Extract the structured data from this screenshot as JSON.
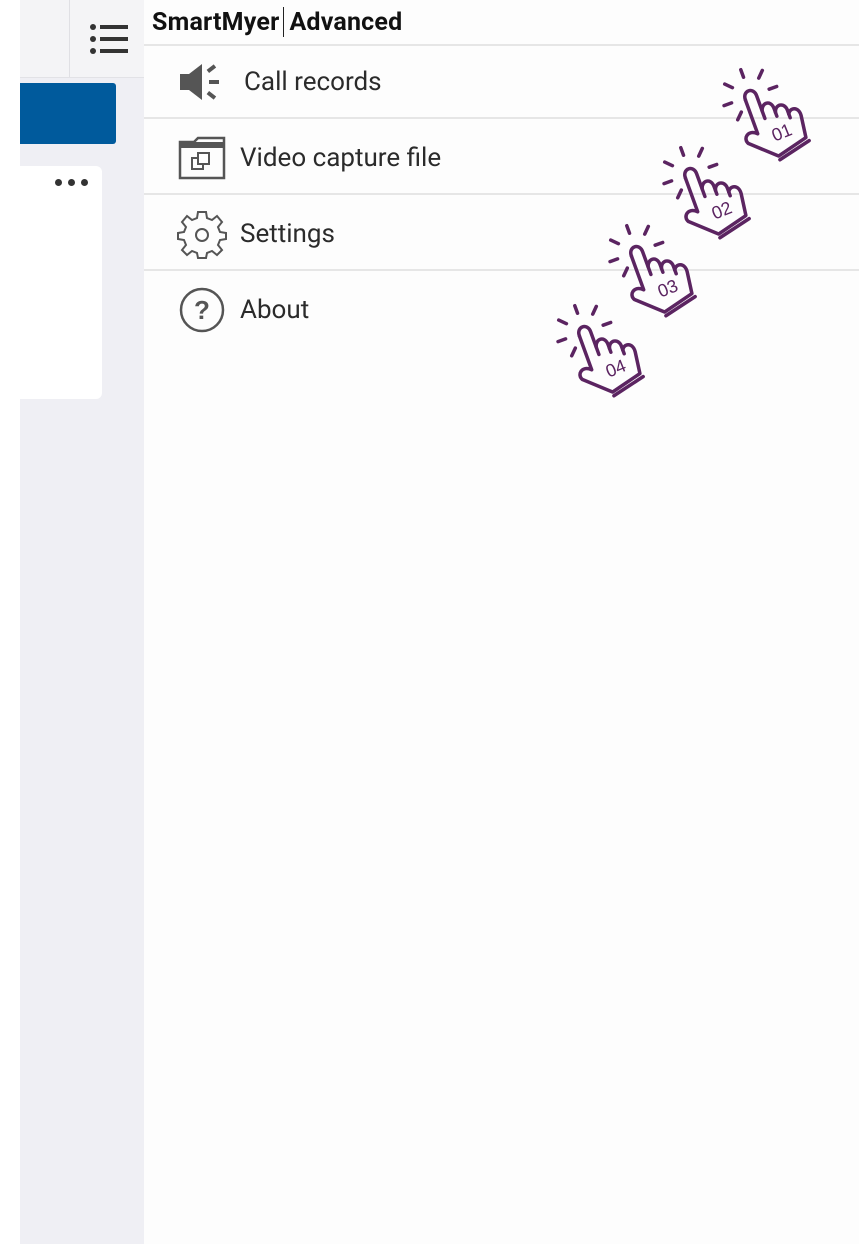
{
  "app": {
    "title_left": "SmartMyer",
    "title_right": "Advanced"
  },
  "menu": {
    "items": [
      {
        "label": "Call records",
        "icon": "speaker-icon"
      },
      {
        "label": "Video capture file",
        "icon": "folder-icon"
      },
      {
        "label": "Settings",
        "icon": "gear-icon"
      },
      {
        "label": "About",
        "icon": "help-circle-icon"
      }
    ]
  },
  "annotations": {
    "steps": [
      "01",
      "02",
      "03",
      "04"
    ],
    "icon": "tap-hand-icon",
    "color": "#5b2461"
  },
  "colors": {
    "accent": "#005a9c",
    "background_panel": "#efeff4"
  }
}
